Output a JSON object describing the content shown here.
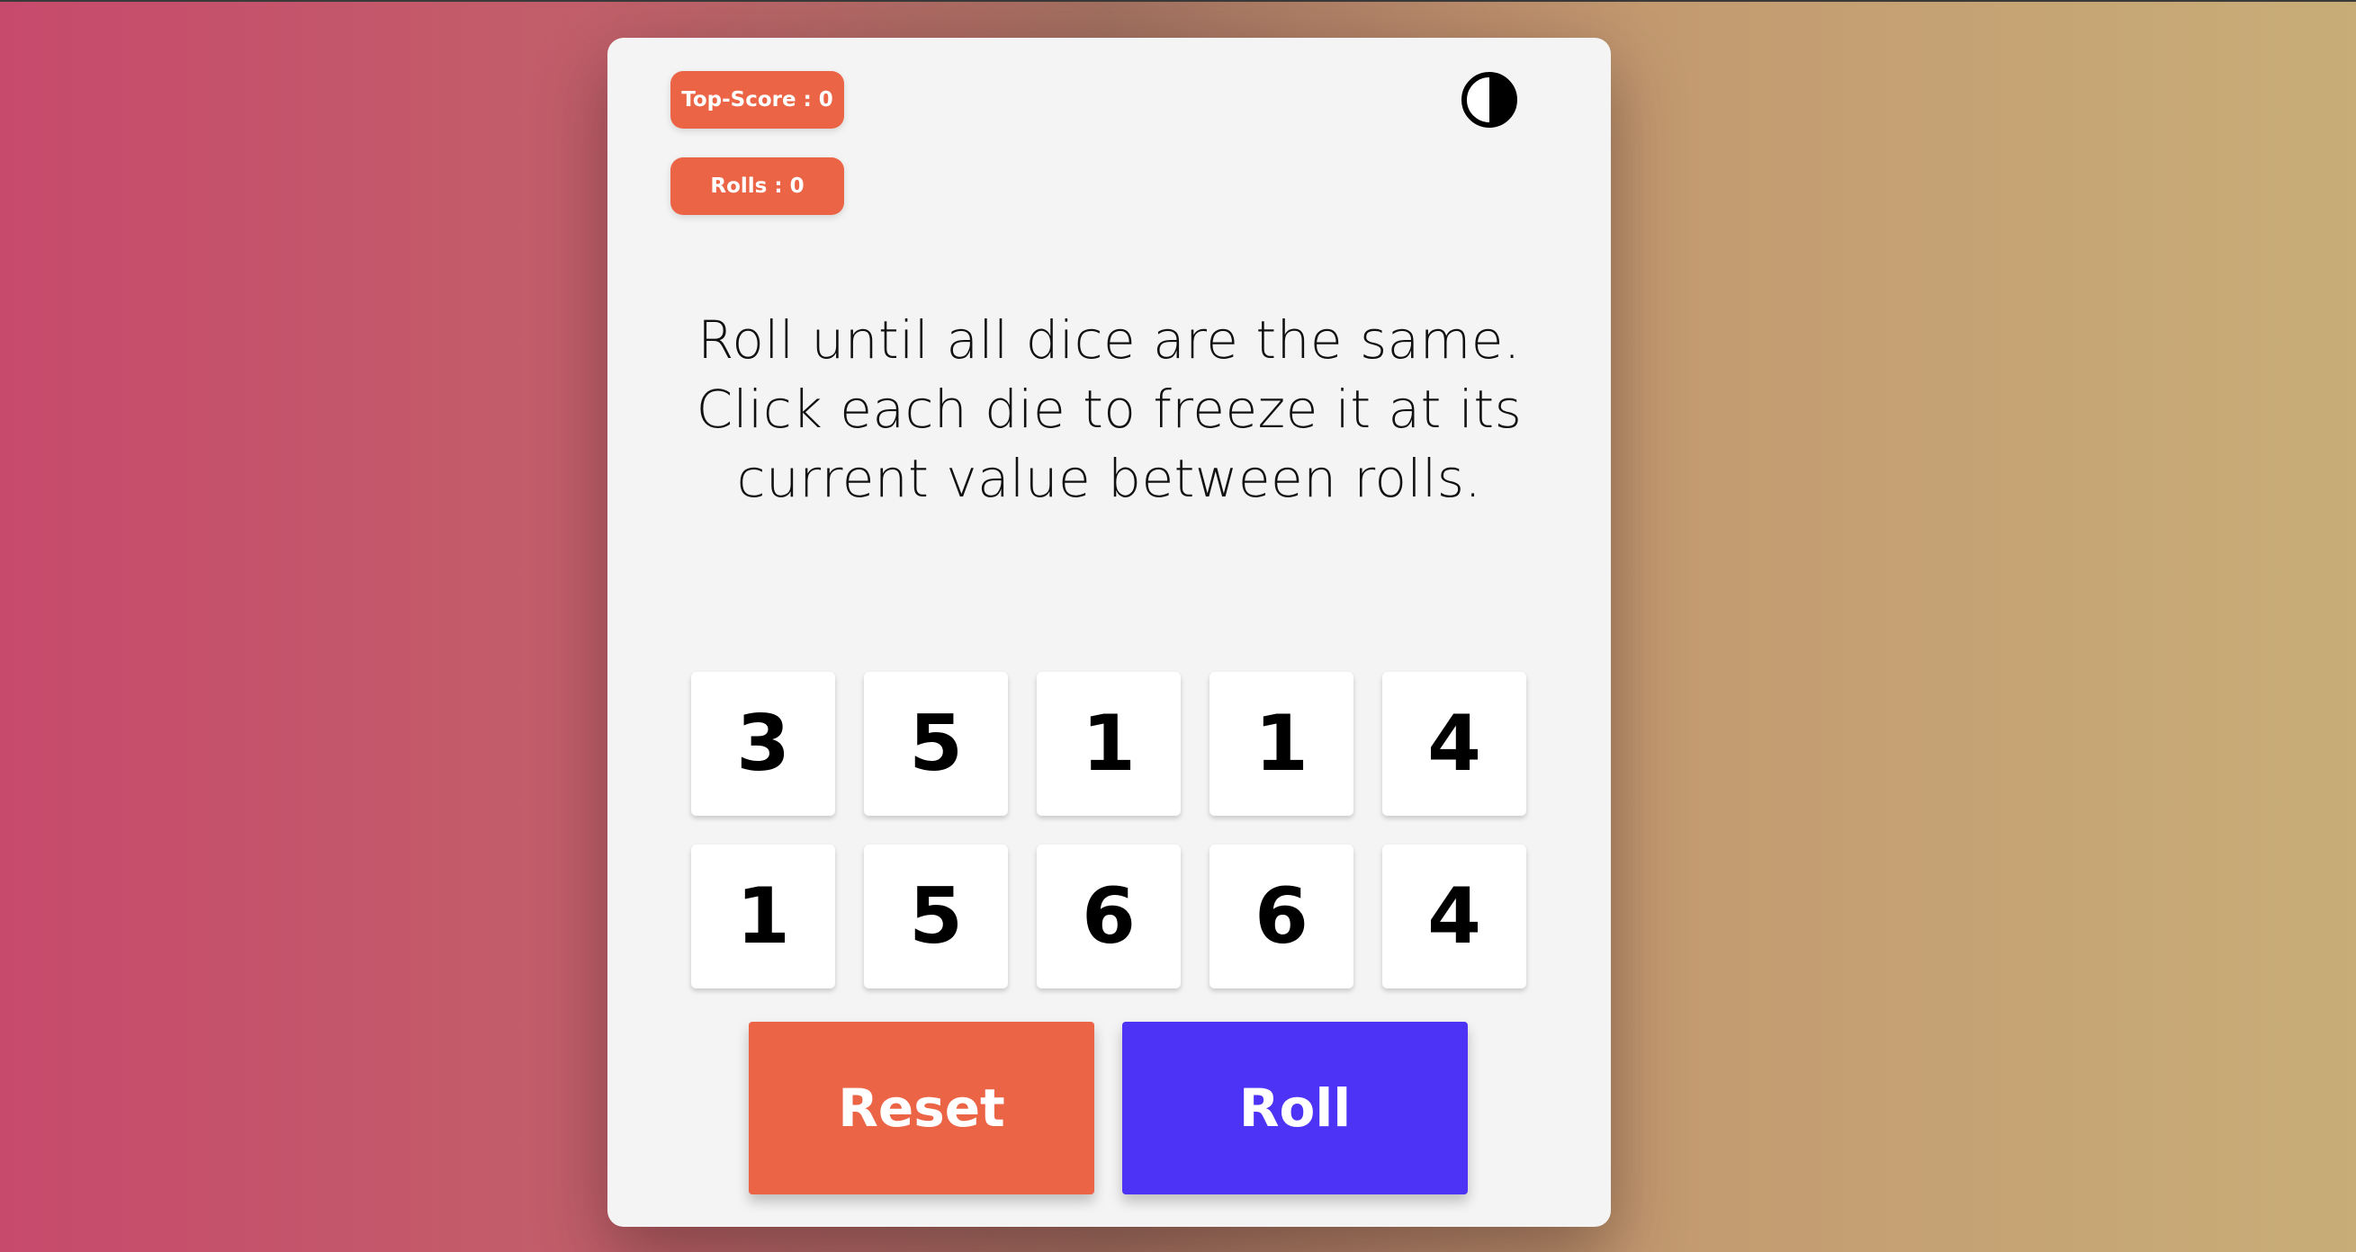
{
  "stats": {
    "top_score": "Top-Score : 0",
    "rolls": "Rolls : 0"
  },
  "theme_toggle": {
    "icon": "contrast-icon"
  },
  "instructions": "Roll until all dice are the same. Click each die to freeze it at its current value between rolls.",
  "dice": [
    "3",
    "5",
    "1",
    "1",
    "4",
    "1",
    "5",
    "6",
    "6",
    "4"
  ],
  "buttons": {
    "reset": "Reset",
    "roll": "Roll"
  },
  "colors": {
    "accent_orange": "#ec6446",
    "accent_blue": "#4c33f5",
    "card_bg": "#f4f4f4"
  }
}
